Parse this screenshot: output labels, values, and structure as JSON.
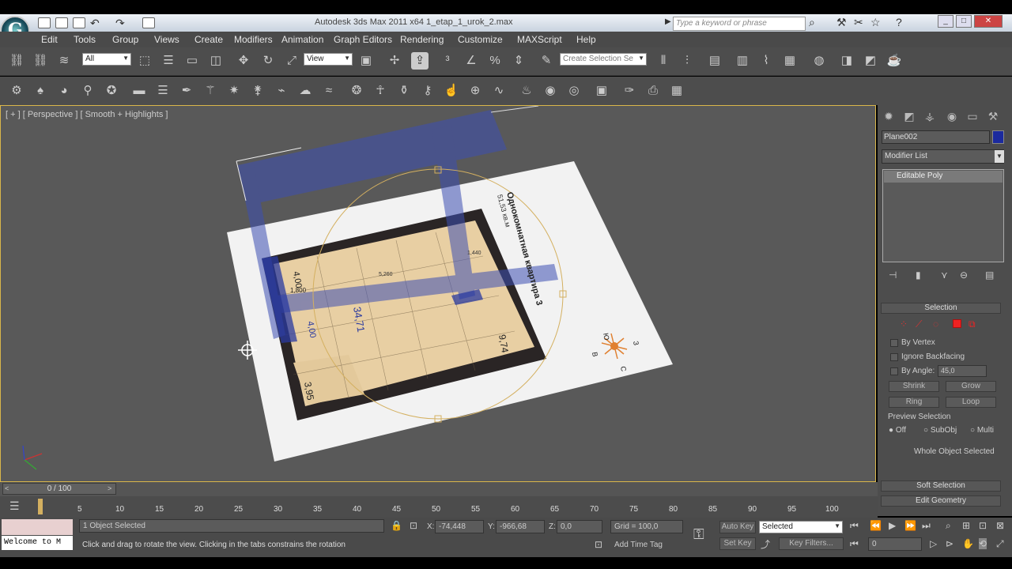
{
  "title": "Autodesk 3ds Max  2011 x64     1_etap_1_urok_2.max",
  "search_placeholder": "Type a keyword or phrase",
  "menu": [
    "Edit",
    "Tools",
    "Group",
    "Views",
    "Create",
    "Modifiers",
    "Animation",
    "Graph Editors",
    "Rendering",
    "Customize",
    "MAXScript",
    "Help"
  ],
  "toolbar": {
    "filter": "All",
    "ref_coord": "View",
    "named_selection": "Create Selection Se"
  },
  "viewport": {
    "label": "[ + ] [ Perspective ] [ Smooth + Highlights ]"
  },
  "plan_text": {
    "title": "Однокомнатная квартира 3",
    "area": "51,53 кв.м",
    "rooms": [
      "4,00",
      "1,800",
      "34,71",
      "4,00",
      "3,95",
      "9,74",
      "5,260",
      "1,440"
    ],
    "compass": [
      "Ю",
      "З",
      "С",
      "В"
    ]
  },
  "cmd_panel": {
    "object_name": "Plane002",
    "object_color": "#1b2a9e",
    "modifier_list": "Modifier List",
    "stack": [
      "Editable Poly"
    ],
    "selection": {
      "header": "Selection",
      "by_vertex": "By Vertex",
      "ignore_backfacing": "Ignore Backfacing",
      "by_angle": "By Angle:",
      "angle_value": "45,0",
      "shrink": "Shrink",
      "grow": "Grow",
      "ring": "Ring",
      "loop": "Loop",
      "preview": "Preview Selection",
      "preview_opts": [
        "Off",
        "SubObj",
        "Multi"
      ],
      "whole": "Whole Object Selected"
    },
    "soft_selection": "Soft Selection",
    "edit_geometry": "Edit Geometry"
  },
  "time": {
    "slider": "0 / 100",
    "ticks": [
      "5",
      "10",
      "15",
      "20",
      "25",
      "30",
      "35",
      "40",
      "45",
      "50",
      "55",
      "60",
      "65",
      "70",
      "75",
      "80",
      "85",
      "90",
      "95",
      "100"
    ]
  },
  "status": {
    "selected": "1 Object Selected",
    "prompt": "Click and drag to rotate the view.  Clicking in the tabs constrains the rotation",
    "maxscript": "Welcome to M",
    "x_label": "X:",
    "x_value": "-74,448",
    "y_label": "Y:",
    "y_value": "-966,68",
    "z_label": "Z:",
    "z_value": "0,0",
    "grid": "Grid = 100,0",
    "add_time_tag": "Add Time Tag",
    "auto_key": "Auto Key",
    "set_key": "Set Key",
    "key_mode": "Selected",
    "key_filters": "Key Filters...",
    "frame": "0"
  }
}
